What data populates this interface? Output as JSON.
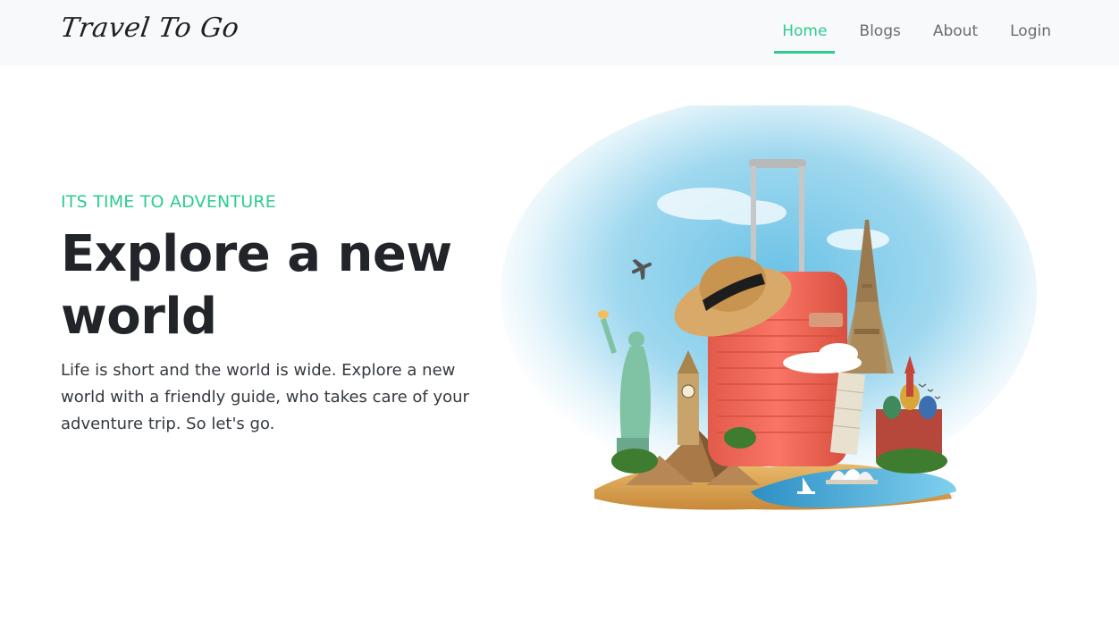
{
  "nav": {
    "logo": "Travel To Go",
    "links": [
      {
        "label": "Home",
        "active": true
      },
      {
        "label": "Blogs",
        "active": false
      },
      {
        "label": "About",
        "active": false
      },
      {
        "label": "Login",
        "active": false
      }
    ]
  },
  "hero": {
    "eyebrow": "ITS TIME TO ADVENTURE",
    "headline_line1": "Explore a new",
    "headline_line2": "world",
    "description": "Life is short and the world is wide. Explore a new world with a friendly guide, who takes care of your adventure trip. So let's go."
  },
  "colors": {
    "accent": "#2ecc8f",
    "navbar_bg": "#f8f9fa",
    "headline": "#212529"
  }
}
